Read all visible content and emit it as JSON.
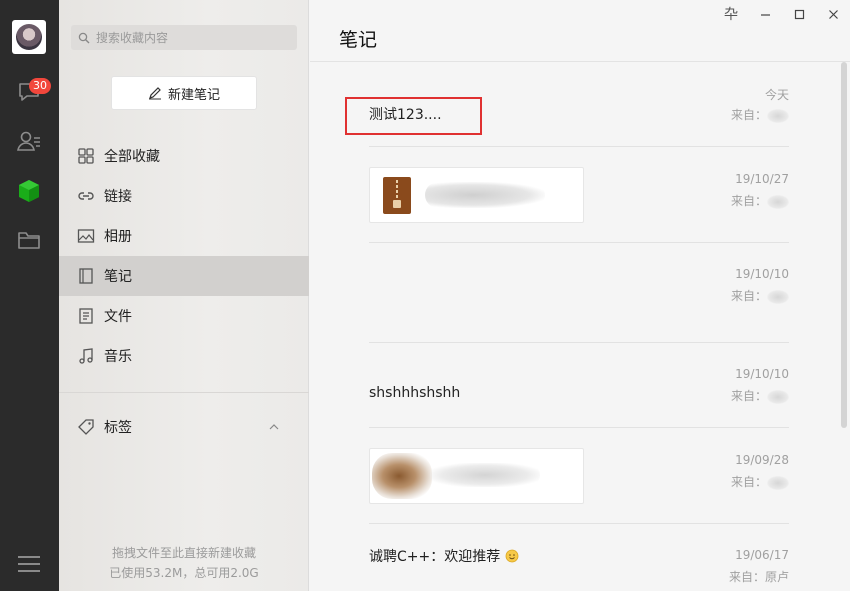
{
  "rail": {
    "badge_count": "30",
    "icons": [
      "chat-icon",
      "contacts-icon",
      "favorites-cube-icon",
      "folder-icon",
      "menu-icon"
    ]
  },
  "sidebar": {
    "search_placeholder": "搜索收藏内容",
    "new_note_label": "新建笔记",
    "items": [
      {
        "label": "全部收藏",
        "icon": "grid-icon"
      },
      {
        "label": "链接",
        "icon": "link-icon"
      },
      {
        "label": "相册",
        "icon": "image-icon"
      },
      {
        "label": "笔记",
        "icon": "note-icon",
        "active": true
      },
      {
        "label": "文件",
        "icon": "file-icon"
      },
      {
        "label": "音乐",
        "icon": "music-icon"
      }
    ],
    "tags_label": "标签",
    "storage_hint": "拖拽文件至此直接新建收藏",
    "storage_usage": "已使用53.2M，总可用2.0G"
  },
  "window": {
    "pin": "卆",
    "accent": "#07c160"
  },
  "main": {
    "title": "笔记",
    "items": [
      {
        "text": "测试123....",
        "date": "今天",
        "source": "来自："
      },
      {
        "text": "",
        "date": "19/10/27",
        "source": "来自："
      },
      {
        "text": "",
        "date": "19/10/10",
        "source": "来自："
      },
      {
        "text": "shshhhshshh",
        "date": "19/10/10",
        "source": "来自："
      },
      {
        "text": "",
        "date": "19/09/28",
        "source": "来自："
      },
      {
        "text": "诚聘C++：欢迎推荐",
        "date": "19/06/17",
        "source": "来自：原卢"
      }
    ]
  }
}
